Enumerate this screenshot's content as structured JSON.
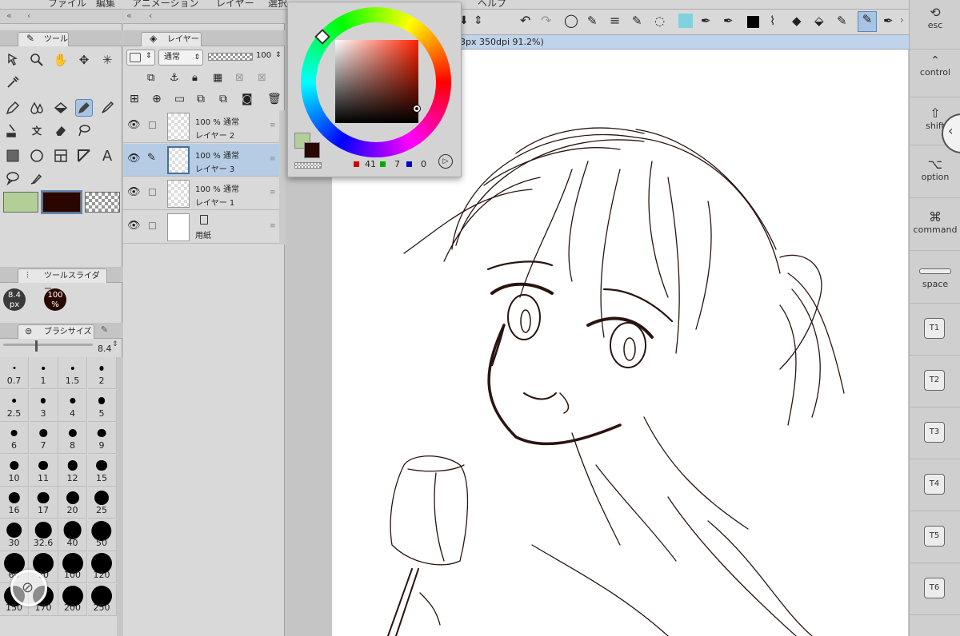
{
  "menu": {
    "items": [
      "ファイル",
      "編集",
      "アニメーション",
      "レイヤー",
      "選択",
      "ヘルプ"
    ]
  },
  "tool_panel": {
    "tab_label": "ツール",
    "swatches": {
      "main": "#b3cf98",
      "sub": "#290700"
    }
  },
  "tool_slider": {
    "tab_label": "ツールスライダー",
    "size_value": "8.4",
    "size_unit": "px",
    "opacity_value": "100",
    "opacity_unit": "%"
  },
  "brush_size": {
    "tab_label": "ブラシサイズ",
    "current": "8.4",
    "sizes": [
      "0.7",
      "1",
      "1.5",
      "2",
      "2.5",
      "3",
      "4",
      "5",
      "6",
      "7",
      "8",
      "9",
      "10",
      "11",
      "12",
      "15",
      "16",
      "17",
      "20",
      "25",
      "30",
      "32.6",
      "40",
      "50",
      "60",
      "70",
      "100",
      "120",
      "150",
      "170",
      "200",
      "250"
    ]
  },
  "layer_panel": {
    "tab_label": "レイヤー",
    "blend_mode": "通常",
    "opacity": "100",
    "layers": [
      {
        "mode": "100 % 通常",
        "name": "レイヤー 2"
      },
      {
        "mode": "100 % 通常",
        "name": "レイヤー 3"
      },
      {
        "mode": "100 % 通常",
        "name": "レイヤー 1"
      },
      {
        "name": "用紙"
      }
    ]
  },
  "status_bar": {
    "text": "93px 350dpi 91.2%)"
  },
  "color_popup": {
    "r": "41",
    "g": "7",
    "b": "0",
    "selected_hex": "#290700"
  },
  "right_bar": {
    "keys": [
      "esc",
      "control",
      "shift",
      "option",
      "command",
      "space"
    ],
    "t_keys": [
      "T1",
      "T2",
      "T3",
      "T4",
      "T5",
      "T6"
    ]
  },
  "colors": {
    "selection": "#b6cce4",
    "accent": "#5d86b6"
  }
}
